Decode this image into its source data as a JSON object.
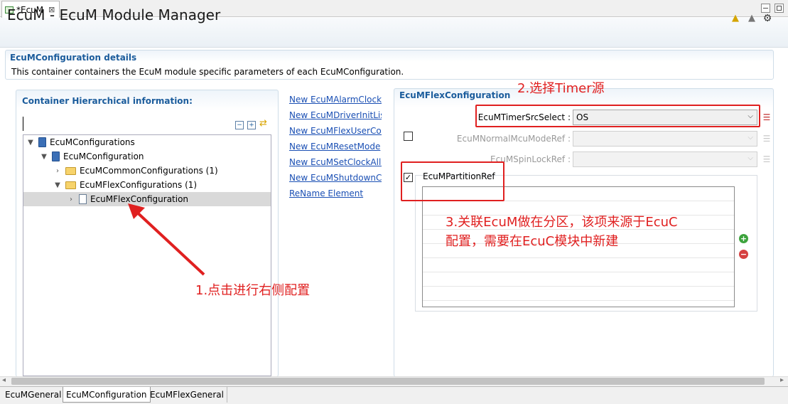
{
  "editor_tab": {
    "label": "*EcuM",
    "close": "⊠"
  },
  "header": {
    "title": "EcuM - EcuM Module Manager"
  },
  "details": {
    "title": "EcuMConfiguration details",
    "description": "This container containers the EcuM module specific parameters of each EcuMConfiguration."
  },
  "hierarchy": {
    "title": "Container Hierarchical information:",
    "filter_value": "",
    "tree": [
      {
        "label": "EcuMConfigurations",
        "level": 0,
        "expanded": true,
        "icon": "book-icon"
      },
      {
        "label": "EcuMConfiguration",
        "level": 1,
        "expanded": true,
        "icon": "book-icon"
      },
      {
        "label": "EcuMCommonConfigurations (1)",
        "level": 2,
        "expanded": false,
        "icon": "folder-icon"
      },
      {
        "label": "EcuMFlexConfigurations (1)",
        "level": 2,
        "expanded": true,
        "icon": "folder-icon"
      },
      {
        "label": "EcuMFlexConfiguration",
        "level": 3,
        "expanded": false,
        "icon": "document-icon",
        "selected": true
      }
    ]
  },
  "links": [
    "New EcuMAlarmClock",
    "New EcuMDriverInitList",
    "New EcuMFlexUserConfig",
    "New EcuMResetMode",
    "New EcuMSetClockAllowedUser",
    "New EcuMShutdownCause",
    "ReName Element"
  ],
  "flex": {
    "title": "EcuMFlexConfiguration",
    "timer_label": "EcuMTimerSrcSelect :",
    "timer_value": "OS",
    "normal_label": "EcuMNormalMcuModeRef :",
    "spin_label": "EcuMSpinLockRef :",
    "partition_label": "EcuMPartitionRef",
    "partition_checked": "✓"
  },
  "annotations": {
    "step1": "1.点击进行右侧配置",
    "step2": "2.选择Timer源",
    "step3_line1": "3.关联EcuM做在分区，该项来源于EcuC",
    "step3_line2": "配置，需要在EcuC模块中新建"
  },
  "bottom_tabs": [
    "EcuMGeneral",
    "EcuMConfiguration",
    "EcuMFlexGeneral"
  ],
  "colors": {
    "section_title": "#1b5c9c",
    "link": "#1a4fb4",
    "annotation": "#e02020"
  }
}
